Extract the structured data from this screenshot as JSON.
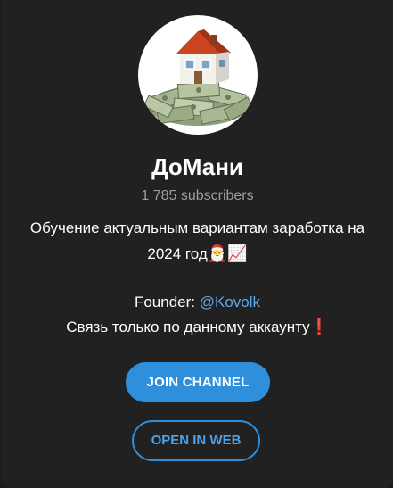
{
  "channel": {
    "title": "ДоМани",
    "subscribers": "1 785 subscribers",
    "description": {
      "line1": "Обучение актуальным вариантам заработка на",
      "line2_text": "2024 год",
      "line2_icons": [
        "santa-emoji",
        "chart-increasing-emoji"
      ],
      "founder_label": "Founder: ",
      "founder_handle": "@Kovolk",
      "contact_text": "Связь только по данному аккаунту",
      "contact_icon": "red-exclamation-emoji"
    },
    "avatar_icon": "house-on-money-avatar"
  },
  "buttons": {
    "join": "JOIN CHANNEL",
    "open_web": "OPEN IN WEB"
  },
  "colors": {
    "background": "#212121",
    "accent": "#2e8fdc",
    "link": "#5ea9e8",
    "muted_text": "#9e9e9e"
  }
}
